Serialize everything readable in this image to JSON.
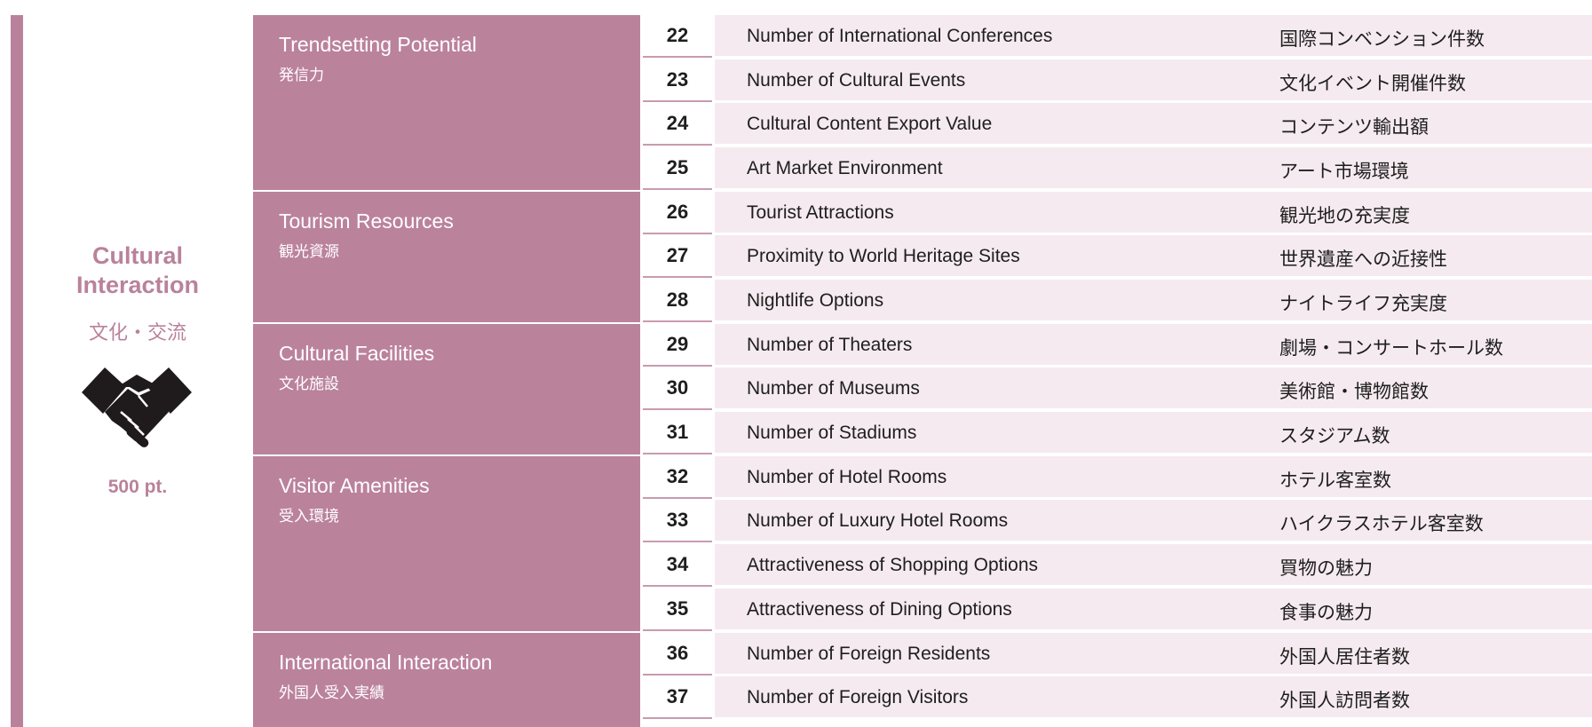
{
  "category": {
    "title_line1": "Cultural",
    "title_line2": "Interaction",
    "title_jp": "文化・交流",
    "icon": "handshake-icon",
    "points": "500 pt."
  },
  "groups": [
    {
      "en": "Trendsetting Potential",
      "jp": "発信力"
    },
    {
      "en": "Tourism Resources",
      "jp": "観光資源"
    },
    {
      "en": "Cultural Facilities",
      "jp": "文化施設"
    },
    {
      "en": "Visitor Amenities",
      "jp": "受入環境"
    },
    {
      "en": "International Interaction",
      "jp": "外国人受入実績"
    }
  ],
  "rows": [
    {
      "num": "22",
      "en": "Number of International Conferences",
      "jp": "国際コンベンション件数"
    },
    {
      "num": "23",
      "en": "Number of Cultural Events",
      "jp": "文化イベント開催件数"
    },
    {
      "num": "24",
      "en": "Cultural Content Export Value",
      "jp": "コンテンツ輸出額"
    },
    {
      "num": "25",
      "en": "Art Market Environment",
      "jp": "アート市場環境"
    },
    {
      "num": "26",
      "en": "Tourist Attractions",
      "jp": "観光地の充実度"
    },
    {
      "num": "27",
      "en": "Proximity to World Heritage Sites",
      "jp": "世界遺産への近接性"
    },
    {
      "num": "28",
      "en": "Nightlife Options",
      "jp": "ナイトライフ充実度"
    },
    {
      "num": "29",
      "en": "Number of Theaters",
      "jp": "劇場・コンサートホール数"
    },
    {
      "num": "30",
      "en": "Number of Museums",
      "jp": "美術館・博物館数"
    },
    {
      "num": "31",
      "en": "Number of Stadiums",
      "jp": "スタジアム数"
    },
    {
      "num": "32",
      "en": "Number of Hotel Rooms",
      "jp": "ホテル客室数"
    },
    {
      "num": "33",
      "en": "Number of Luxury Hotel Rooms",
      "jp": "ハイクラスホテル客室数"
    },
    {
      "num": "34",
      "en": "Attractiveness of Shopping Options",
      "jp": "買物の魅力"
    },
    {
      "num": "35",
      "en": "Attractiveness of Dining Options",
      "jp": "食事の魅力"
    },
    {
      "num": "36",
      "en": "Number of Foreign Residents",
      "jp": "外国人居住者数"
    },
    {
      "num": "37",
      "en": "Number of Foreign Visitors",
      "jp": "外国人訪問者数"
    }
  ]
}
